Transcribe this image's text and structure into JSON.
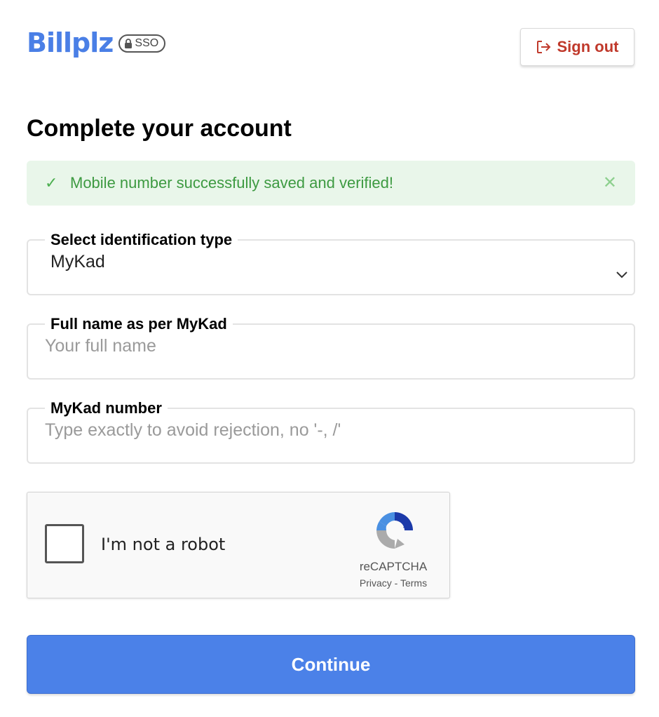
{
  "brand": {
    "logo_text": "Billplz",
    "badge_text": "SSO",
    "color": "#4a7fe6"
  },
  "header": {
    "signout_label": "Sign out",
    "signout_color": "#c0392b"
  },
  "page": {
    "title": "Complete your account"
  },
  "alert": {
    "message": "Mobile number successfully saved and verified!",
    "check_glyph": "✓",
    "close_glyph": "✕",
    "type": "success"
  },
  "form": {
    "id_type": {
      "label": "Select identification type",
      "value": "MyKad"
    },
    "full_name": {
      "label": "Full name as per MyKad",
      "placeholder": "Your full name",
      "value": ""
    },
    "id_number": {
      "label": "MyKad number",
      "placeholder": "Type exactly to avoid rejection, no '-, /'",
      "value": ""
    }
  },
  "captcha": {
    "label": "I'm not a robot",
    "brand": "reCAPTCHA",
    "privacy": "Privacy",
    "separator": " - ",
    "terms": "Terms",
    "checked": false
  },
  "actions": {
    "continue_label": "Continue",
    "continue_color": "#4b81e8"
  }
}
